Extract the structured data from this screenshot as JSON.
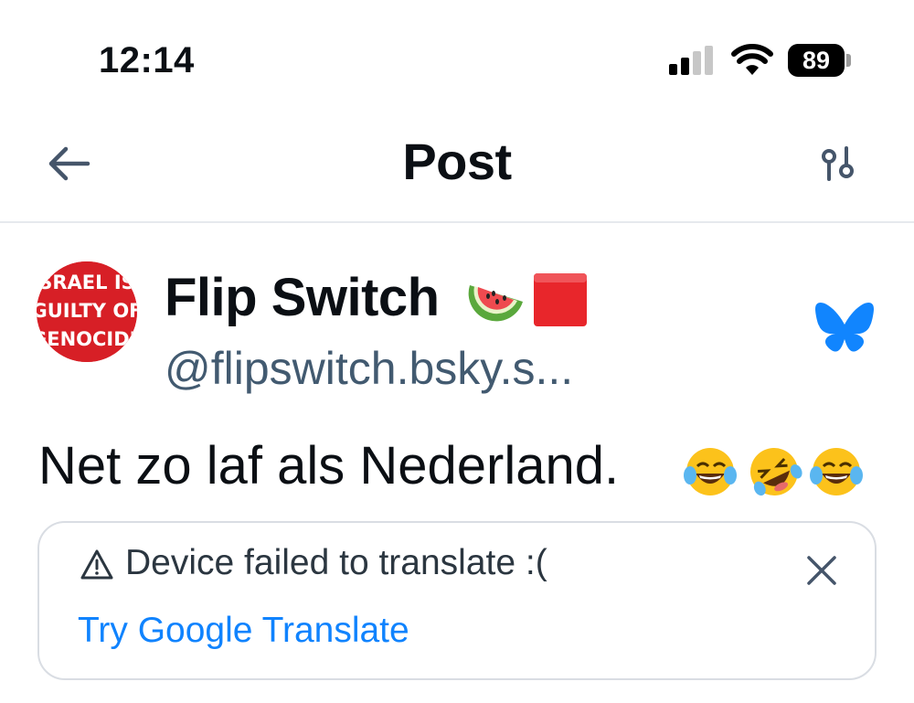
{
  "status_bar": {
    "time": "12:14",
    "battery_level": "89",
    "signal_icon": "cellular-signal-icon",
    "wifi_icon": "wifi-icon"
  },
  "header": {
    "title": "Post",
    "back_icon": "arrow-left-icon",
    "settings_icon": "sliders-icon"
  },
  "author": {
    "name": "Flip Switch",
    "name_emoji": [
      "watermelon",
      "red-square"
    ],
    "handle": "@flipswitch.bsky.s...",
    "avatar_text": [
      "SRAEL IS",
      "GUILTY OF",
      "GENOCIDE"
    ],
    "source_icon": "bluesky-butterfly-icon"
  },
  "post": {
    "text": "Net zo laf als Nederland.",
    "emoji": [
      "face-with-tears-of-joy",
      "rolling-on-the-floor-laughing",
      "face-with-tears-of-joy"
    ]
  },
  "translate": {
    "message": "Device failed to translate :(",
    "link_label": "Try Google Translate",
    "warning_icon": "warning-triangle-icon",
    "close_icon": "close-icon"
  },
  "colors": {
    "handle": "#425a70",
    "link": "#1083fe",
    "bluesky": "#1185fe",
    "avatar_bg": "#d71f26"
  }
}
